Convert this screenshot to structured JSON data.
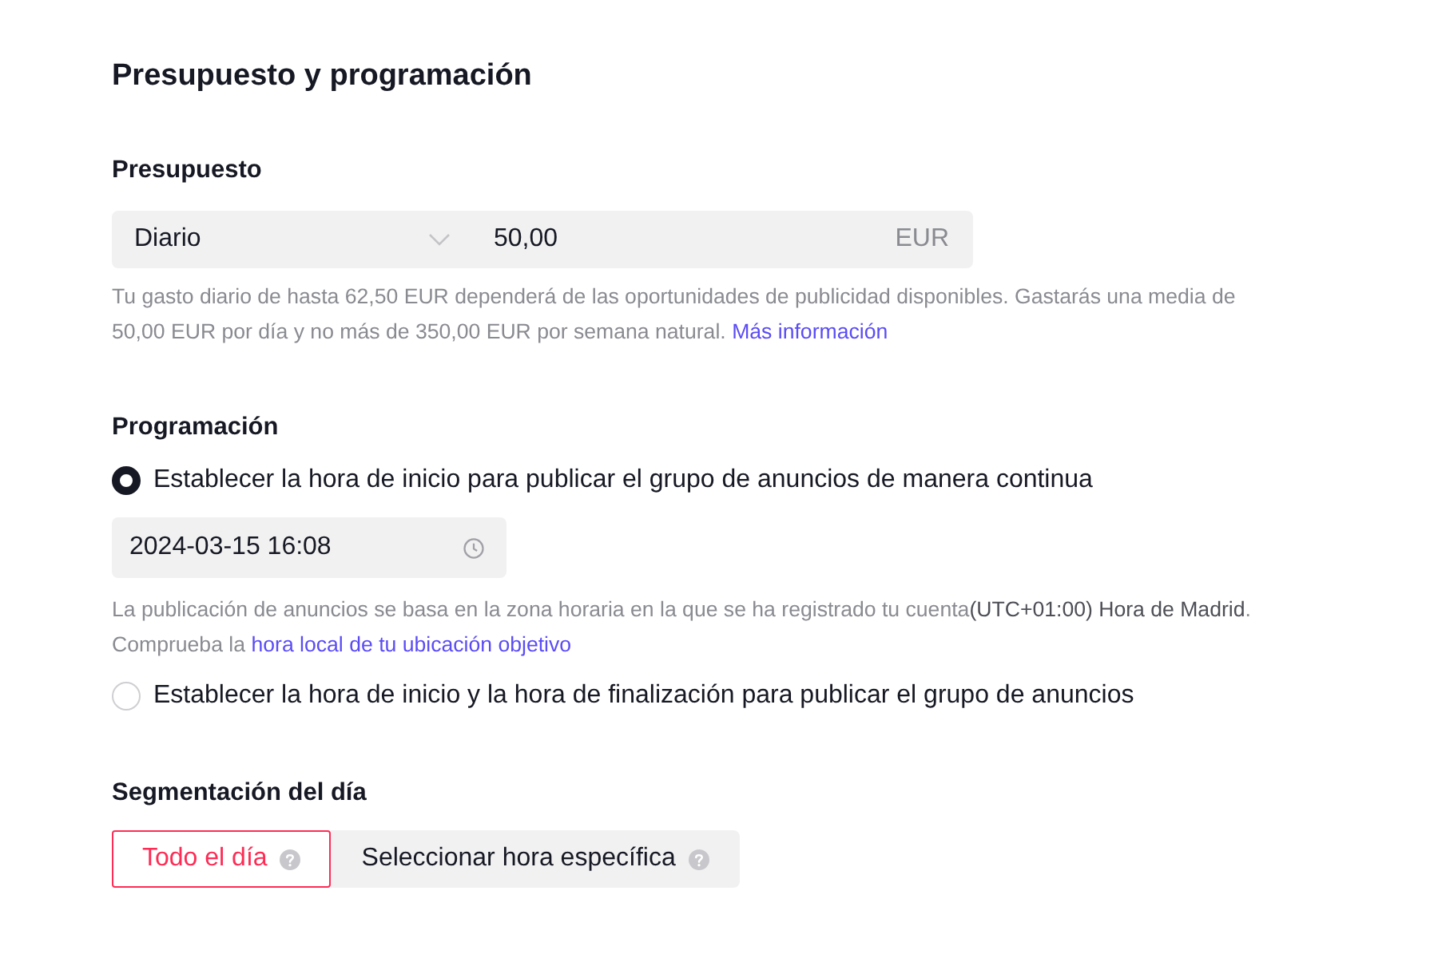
{
  "section": {
    "title": "Presupuesto y programación"
  },
  "budget": {
    "label": "Presupuesto",
    "mode": {
      "value": "Diario"
    },
    "amount": {
      "value": "50,00",
      "currency": "EUR"
    },
    "help": {
      "text": "Tu gasto diario de hasta 62,50 EUR dependerá de las oportunidades de publicidad disponibles. Gastarás una media de 50,00 EUR por día y no más de 350,00 EUR por semana natural.",
      "link": "Más información"
    }
  },
  "schedule": {
    "label": "Programación",
    "options": [
      {
        "label": "Establecer la hora de inicio para publicar el grupo de anuncios de manera continua",
        "selected": true,
        "start_time": {
          "value": "2024-03-15 16:08"
        },
        "note": {
          "text": "La publicación de anuncios se basa en la zona horaria en la que se ha registrado tu cuenta**(UTC+01:00) Hora de Madrid**. Comprueba la",
          "link": "hora local de tu ubicación objetivo"
        }
      },
      {
        "label": "Establecer la hora de inicio y la hora de finalización para publicar el grupo de anuncios",
        "selected": false
      }
    ]
  },
  "day_parting": {
    "label": "Segmentación del día",
    "options": [
      {
        "label": "Todo el día",
        "selected": true
      },
      {
        "label": "Seleccionar hora específica",
        "selected": false
      }
    ]
  }
}
